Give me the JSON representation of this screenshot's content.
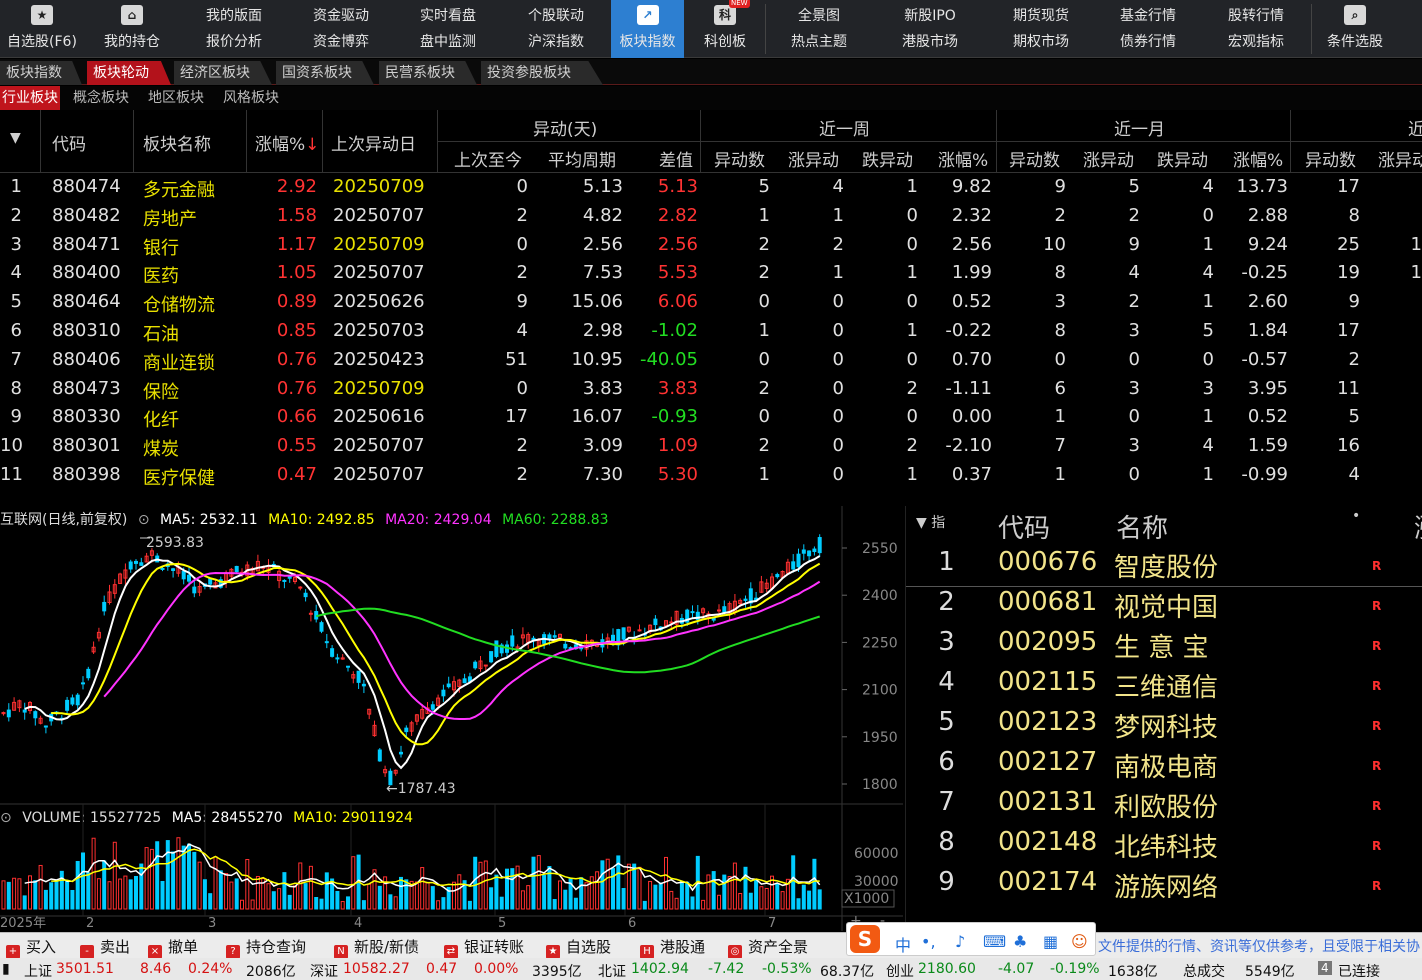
{
  "toolbar": {
    "items": [
      {
        "l1": "",
        "l2": "自选股(F6)",
        "icon": "star-icon"
      },
      {
        "l1": "",
        "l2": "我的持仓",
        "icon": "home-icon"
      },
      {
        "l1": "我的版面",
        "l2": "报价分析"
      },
      {
        "l1": "资金驱动",
        "l2": "资金博弈"
      },
      {
        "l1": "实时看盘",
        "l2": "盘中监测"
      },
      {
        "l1": "个股联动",
        "l2": "沪深指数"
      },
      {
        "l1": "",
        "l2": "板块指数",
        "icon": "chart-line-icon"
      },
      {
        "l1": "",
        "l2": "科创板",
        "icon": "kechuang-icon",
        "badge": "NEW"
      },
      {
        "l1": "全景图",
        "l2": "热点主题"
      },
      {
        "l1": "新股IPO",
        "l2": "港股市场"
      },
      {
        "l1": "期货现货",
        "l2": "期权市场"
      },
      {
        "l1": "基金行情",
        "l2": "债券行情"
      },
      {
        "l1": "股转行情",
        "l2": "宏观指标"
      },
      {
        "l1": "",
        "l2": "条件选股",
        "icon": "filter-search-icon"
      }
    ]
  },
  "tabs": [
    "板块指数",
    "板块轮动",
    "经济区板块",
    "国资系板块",
    "民营系板块",
    "投资参股板块"
  ],
  "subtabs": [
    "行业板块",
    "概念板块",
    "地区板块",
    "风格板块"
  ],
  "table": {
    "headers": {
      "code": "代码",
      "name": "板块名称",
      "pct": "涨幅%",
      "sort_arrow": "↓",
      "last": "上次异动日",
      "group_day": "异动(天)",
      "group_week": "近一周",
      "group_month": "近一月",
      "group_next": "近",
      "since": "上次至今",
      "avg": "平均周期",
      "diff": "差值",
      "cnt": "异动数",
      "up": "涨异动",
      "down": "跌异动",
      "wpct": "涨幅%",
      "mcnt": "异动数",
      "mup": "涨异动",
      "mdown": "跌异动",
      "mpct": "涨幅%",
      "ncnt": "异动数",
      "nup": "涨异动"
    },
    "rows": [
      {
        "n": "1",
        "code": "880474",
        "name": "多元金融",
        "pct": "2.92",
        "last": "20250709",
        "last_hl": true,
        "since": "0",
        "avg": "5.13",
        "diff": "5.13",
        "diff_pos": true,
        "wc": "5",
        "wu": "4",
        "wd": "1",
        "wp": "9.82",
        "mc": "9",
        "mu": "5",
        "md": "4",
        "mp": "13.73",
        "nc": "17",
        "nu": ""
      },
      {
        "n": "2",
        "code": "880482",
        "name": "房地产",
        "pct": "1.58",
        "last": "20250707",
        "last_hl": false,
        "since": "2",
        "avg": "4.82",
        "diff": "2.82",
        "diff_pos": true,
        "wc": "1",
        "wu": "1",
        "wd": "0",
        "wp": "2.32",
        "mc": "2",
        "mu": "2",
        "md": "0",
        "mp": "2.88",
        "nc": "8",
        "nu": ""
      },
      {
        "n": "3",
        "code": "880471",
        "name": "银行",
        "pct": "1.17",
        "last": "20250709",
        "last_hl": true,
        "since": "0",
        "avg": "2.56",
        "diff": "2.56",
        "diff_pos": true,
        "wc": "2",
        "wu": "2",
        "wd": "0",
        "wp": "2.56",
        "mc": "10",
        "mu": "9",
        "md": "1",
        "mp": "9.24",
        "nc": "25",
        "nu": "1"
      },
      {
        "n": "4",
        "code": "880400",
        "name": "医药",
        "pct": "1.05",
        "last": "20250707",
        "last_hl": false,
        "since": "2",
        "avg": "7.53",
        "diff": "5.53",
        "diff_pos": true,
        "wc": "2",
        "wu": "1",
        "wd": "1",
        "wp": "1.99",
        "mc": "8",
        "mu": "4",
        "md": "4",
        "mp": "-0.25",
        "nc": "19",
        "nu": "1"
      },
      {
        "n": "5",
        "code": "880464",
        "name": "仓储物流",
        "pct": "0.89",
        "last": "20250626",
        "last_hl": false,
        "since": "9",
        "avg": "15.06",
        "diff": "6.06",
        "diff_pos": true,
        "wc": "0",
        "wu": "0",
        "wd": "0",
        "wp": "0.52",
        "mc": "3",
        "mu": "2",
        "md": "1",
        "mp": "2.60",
        "nc": "9",
        "nu": ""
      },
      {
        "n": "6",
        "code": "880310",
        "name": "石油",
        "pct": "0.85",
        "last": "20250703",
        "last_hl": false,
        "since": "4",
        "avg": "2.98",
        "diff": "-1.02",
        "diff_pos": false,
        "wc": "1",
        "wu": "0",
        "wd": "1",
        "wp": "-0.22",
        "mc": "8",
        "mu": "3",
        "md": "5",
        "mp": "1.84",
        "nc": "17",
        "nu": ""
      },
      {
        "n": "7",
        "code": "880406",
        "name": "商业连锁",
        "pct": "0.76",
        "last": "20250423",
        "last_hl": false,
        "since": "51",
        "avg": "10.95",
        "diff": "-40.05",
        "diff_pos": false,
        "wc": "0",
        "wu": "0",
        "wd": "0",
        "wp": "0.70",
        "mc": "0",
        "mu": "0",
        "md": "0",
        "mp": "-0.57",
        "nc": "2",
        "nu": ""
      },
      {
        "n": "8",
        "code": "880473",
        "name": "保险",
        "pct": "0.76",
        "last": "20250709",
        "last_hl": true,
        "since": "0",
        "avg": "3.83",
        "diff": "3.83",
        "diff_pos": true,
        "wc": "2",
        "wu": "0",
        "wd": "2",
        "wp": "-1.11",
        "mc": "6",
        "mu": "3",
        "md": "3",
        "mp": "3.95",
        "nc": "11",
        "nu": ""
      },
      {
        "n": "9",
        "code": "880330",
        "name": "化纤",
        "pct": "0.66",
        "last": "20250616",
        "last_hl": false,
        "since": "17",
        "avg": "16.07",
        "diff": "-0.93",
        "diff_pos": false,
        "wc": "0",
        "wu": "0",
        "wd": "0",
        "wp": "0.00",
        "mc": "1",
        "mu": "0",
        "md": "1",
        "mp": "0.52",
        "nc": "5",
        "nu": ""
      },
      {
        "n": "10",
        "code": "880301",
        "name": "煤炭",
        "pct": "0.55",
        "last": "20250707",
        "last_hl": false,
        "since": "2",
        "avg": "3.09",
        "diff": "1.09",
        "diff_pos": true,
        "wc": "2",
        "wu": "0",
        "wd": "2",
        "wp": "-2.10",
        "mc": "7",
        "mu": "3",
        "md": "4",
        "mp": "1.59",
        "nc": "16",
        "nu": ""
      },
      {
        "n": "11",
        "code": "880398",
        "name": "医疗保健",
        "pct": "0.47",
        "last": "20250707",
        "last_hl": false,
        "since": "2",
        "avg": "7.30",
        "diff": "5.30",
        "diff_pos": true,
        "wc": "1",
        "wu": "0",
        "wd": "1",
        "wp": "0.37",
        "mc": "1",
        "mu": "0",
        "md": "1",
        "mp": "-0.99",
        "nc": "4",
        "nu": ""
      }
    ]
  },
  "kline": {
    "title": "互联网(日线,前复权)",
    "ma5": "MA5: 2532.11",
    "ma10": "MA10: 2492.85",
    "ma20": "MA20: 2429.04",
    "ma60": "MA60: 2288.83",
    "high_label": "2593.83",
    "low_label": "←1787.43",
    "yticks": [
      "2550",
      "2400",
      "2250",
      "2100",
      "1950",
      "1800"
    ],
    "vol_info": "VOLUME: 15527725",
    "vol_ma5": "MA5: 28455270",
    "vol_ma10": "MA10: 29011924",
    "vol_ticks": [
      "60000",
      "30000"
    ],
    "vol_unit": "X1000",
    "xlabels": [
      "2025年",
      "2",
      "3",
      "4",
      "5",
      "6",
      "7"
    ],
    "colors": {
      "up": "#ff3030",
      "down": "#00ccff",
      "ma5": "#ffffff",
      "ma10": "#ffff00",
      "ma20": "#ff33ff",
      "ma60": "#22dd22"
    }
  },
  "rpanel": {
    "sort_label": "指",
    "h_code": "代码",
    "h_name": "名称",
    "h_dot": "•",
    "h_more": "涨",
    "rows": [
      {
        "n": "1",
        "code": "000676",
        "name": "智度股份",
        "tag": "R"
      },
      {
        "n": "2",
        "code": "000681",
        "name": "视觉中国",
        "tag": "R"
      },
      {
        "n": "3",
        "code": "002095",
        "name": "生 意 宝",
        "tag": "R"
      },
      {
        "n": "4",
        "code": "002115",
        "name": "三维通信",
        "tag": "R"
      },
      {
        "n": "5",
        "code": "002123",
        "name": "梦网科技",
        "tag": "R"
      },
      {
        "n": "6",
        "code": "002127",
        "name": "南极电商",
        "tag": "R"
      },
      {
        "n": "7",
        "code": "002131",
        "name": "利欧股份",
        "tag": "R"
      },
      {
        "n": "8",
        "code": "002148",
        "name": "北纬科技",
        "tag": "R"
      },
      {
        "n": "9",
        "code": "002174",
        "name": "游族网络",
        "tag": "R"
      }
    ]
  },
  "actionbar": [
    "买入",
    "卖出",
    "撤单",
    "持仓查询",
    "新股/新债",
    "银证转账",
    "自选股",
    "港股通",
    "资产全景"
  ],
  "disclaimer": "文件提供的行情、资讯等仅供参考，且受限于相关协",
  "statusbar": {
    "sh_label": "上证",
    "sh_val": "3501.51",
    "sh_chg": "8.46",
    "sh_pct": "0.24%",
    "sh_amt": "2086亿",
    "sz_label": "深证",
    "sz_val": "10582.27",
    "sz_chg": "0.47",
    "sz_pct": "0.00%",
    "sz_amt": "3395亿",
    "bz_label": "北证",
    "bz_val": "1402.94",
    "bz_chg": "-7.42",
    "bz_pct": "-0.53%",
    "bz_amt": "68.37亿",
    "cy_label": "创业",
    "cy_val": "2180.60",
    "cy_chg": "-4.07",
    "cy_pct": "-0.19%",
    "cy_amt": "1638亿",
    "total_label": "总成交",
    "total_val": "5549亿",
    "conn_num": "4",
    "conn": "已连接"
  }
}
